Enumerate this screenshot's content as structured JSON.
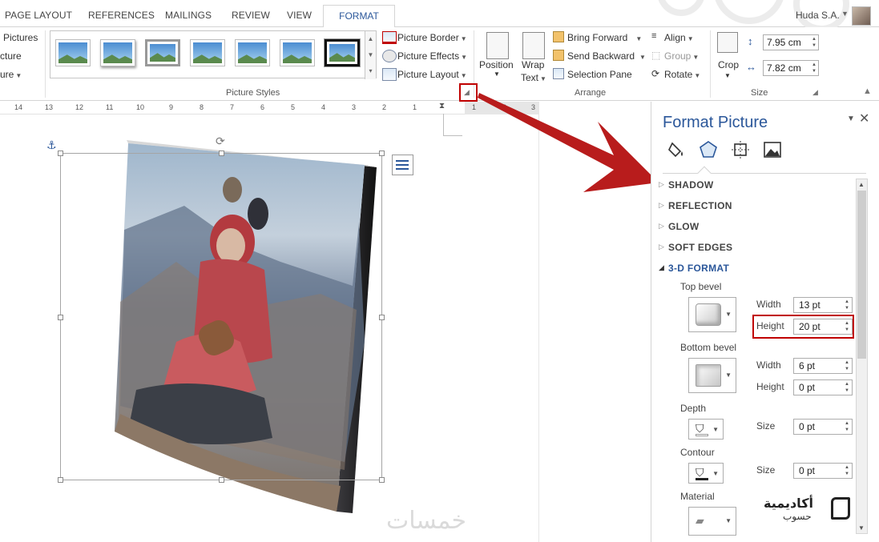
{
  "tabs": [
    "PAGE LAYOUT",
    "REFERENCES",
    "MAILINGS",
    "REVIEW",
    "VIEW"
  ],
  "active_tab": "FORMAT",
  "user": {
    "name": "Huda S.A."
  },
  "ribbon": {
    "left_partial": [
      "Pictures",
      "cture",
      "ure"
    ],
    "picture_styles": {
      "label": "Picture Styles",
      "commands": [
        "Picture Border",
        "Picture Effects",
        "Picture Layout"
      ]
    },
    "arrange": {
      "label": "Arrange",
      "position": "Position",
      "wrap_text": [
        "Wrap",
        "Text"
      ],
      "commands": [
        "Bring Forward",
        "Send Backward",
        "Selection Pane"
      ],
      "align": "Align",
      "group": "Group",
      "rotate": "Rotate"
    },
    "size": {
      "label": "Size",
      "crop": "Crop",
      "height": "7.95 cm",
      "width": "7.82 cm"
    }
  },
  "ruler": {
    "ticks": [
      "14",
      "13",
      "12",
      "11",
      "10",
      "9",
      "8",
      "7",
      "6",
      "5",
      "4",
      "3",
      "2",
      "1",
      "1",
      "2",
      "3"
    ]
  },
  "watermark": "خمسات",
  "pane": {
    "title": "Format Picture",
    "tabs": [
      "fill-line-icon",
      "effects-icon",
      "layout-properties-icon",
      "picture-icon"
    ],
    "sections": [
      "SHADOW",
      "REFLECTION",
      "GLOW",
      "SOFT EDGES",
      "3-D FORMAT"
    ],
    "top_bevel": {
      "label": "Top bevel",
      "width_label": "Width",
      "width": "13 pt",
      "height_label": "Height",
      "height": "20 pt"
    },
    "bottom_bevel": {
      "label": "Bottom bevel",
      "width_label": "Width",
      "width": "6 pt",
      "height_label": "Height",
      "height": "0 pt"
    },
    "depth": {
      "label": "Depth",
      "size_label": "Size",
      "size": "0 pt"
    },
    "contour": {
      "label": "Contour",
      "size_label": "Size",
      "size": "0 pt"
    },
    "material": {
      "label": "Material"
    }
  },
  "logo": {
    "line1": "أكاديمية",
    "line2": "حسوب"
  },
  "colors": {
    "accent": "#2b579a",
    "highlight": "#c00000",
    "arrow": "#b81c1c"
  }
}
